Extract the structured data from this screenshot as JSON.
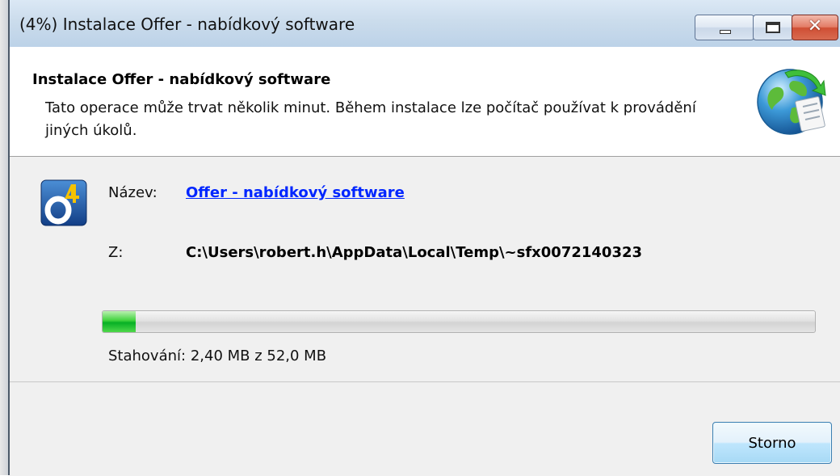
{
  "window": {
    "title": "(4%) Instalace Offer - nabídkový software",
    "controls": {
      "minimize_icon": "minimize-icon",
      "maximize_icon": "maximize-icon",
      "close_label": "✕"
    }
  },
  "header": {
    "title": "Instalace Offer - nabídkový software",
    "description": "Tato operace může trvat několik minut. Během instalace lze počítač používat k provádění jiných úkolů.",
    "icon": "globe-install-icon"
  },
  "details": {
    "app_icon": "offer-app-icon",
    "name_label": "Název:",
    "name_value": "Offer - nabídkový software",
    "from_label": "Z:",
    "from_value": "C:\\Users\\robert.h\\AppData\\Local\\Temp\\~sfx0072140323"
  },
  "progress": {
    "fraction": 0.046,
    "status": "Stahování: 2,40 MB z 52,0 MB",
    "bar_color": "#06b025"
  },
  "footer": {
    "cancel_label": "Storno"
  },
  "colors": {
    "link": "#0026ff",
    "close_button": "#cf4f34",
    "titlebar": "#cbdcec"
  }
}
